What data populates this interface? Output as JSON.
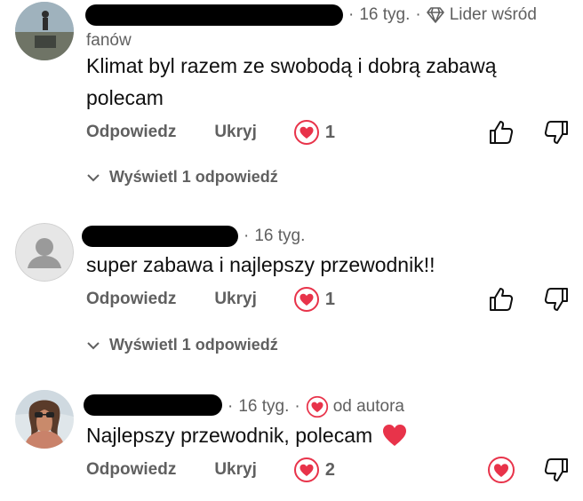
{
  "comments": [
    {
      "time": "16 tyg.",
      "badge": "Lider wśród fanów",
      "badge_line1": "Lider wśród",
      "badge_line2": "fanów",
      "text_line1": "Klimat byl razem ze swobodą i dobrą zabawą",
      "text_line2": "polecam",
      "reply_label": "Odpowiedz",
      "hide_label": "Ukryj",
      "heart_count": "1",
      "view_replies": "Wyświetl 1 odpowiedź"
    },
    {
      "time": "16 tyg.",
      "text_line1": "super zabawa i najlepszy przewodnik!!",
      "reply_label": "Odpowiedz",
      "hide_label": "Ukryj",
      "heart_count": "1",
      "view_replies": "Wyświetl 1 odpowiedź"
    },
    {
      "time": "16 tyg.",
      "author_badge": "od autora",
      "text_line1": "Najlepszy przewodnik, polecam",
      "emoji": "❤️",
      "reply_label": "Odpowiedz",
      "hide_label": "Ukryj",
      "heart_count": "2"
    }
  ],
  "colors": {
    "heart": "#e8334a",
    "meta_text": "#606060",
    "body_text": "#0f0f0f"
  },
  "icons": [
    "diamond-icon",
    "heart-badge-icon",
    "thumbs-up-icon",
    "thumbs-down-icon",
    "chevron-down-icon",
    "default-avatar-icon"
  ]
}
